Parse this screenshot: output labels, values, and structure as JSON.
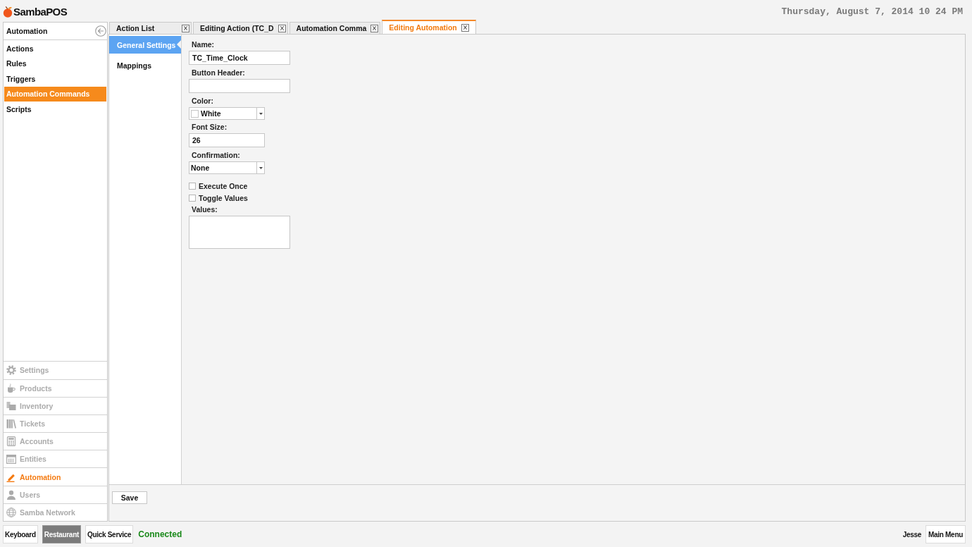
{
  "header": {
    "logo": "SambaPOS",
    "datetime": "Thursday, August 7, 2014 10 24 PM"
  },
  "sidebar": {
    "title": "Automation",
    "items": [
      {
        "label": "Actions",
        "selected": false
      },
      {
        "label": "Rules",
        "selected": false
      },
      {
        "label": "Triggers",
        "selected": false
      },
      {
        "label": "Automation Commands",
        "selected": true
      },
      {
        "label": "Scripts",
        "selected": false
      }
    ],
    "modules": [
      {
        "label": "Settings",
        "selected": false
      },
      {
        "label": "Products",
        "selected": false
      },
      {
        "label": "Inventory",
        "selected": false
      },
      {
        "label": "Tickets",
        "selected": false
      },
      {
        "label": "Accounts",
        "selected": false
      },
      {
        "label": "Entities",
        "selected": false
      },
      {
        "label": "Automation",
        "selected": true
      },
      {
        "label": "Users",
        "selected": false
      },
      {
        "label": "Samba Network",
        "selected": false
      }
    ]
  },
  "tabs": [
    {
      "label": "Action List",
      "selected": false
    },
    {
      "label": "Editing Action (TC_D",
      "selected": false
    },
    {
      "label": "Automation Comma",
      "selected": false
    },
    {
      "label": "Editing Automation",
      "selected": true
    }
  ],
  "editor": {
    "sections": [
      {
        "label": "General Settings",
        "selected": true
      },
      {
        "label": "Mappings",
        "selected": false
      }
    ],
    "fields": [
      {
        "kind": "text",
        "label": "Name:",
        "value": "TC_Time_Clock"
      },
      {
        "kind": "text",
        "label": "Button Header:"
      },
      {
        "kind": "dropdown",
        "label": "Color:",
        "value": "White",
        "color": "#ffffff"
      },
      {
        "kind": "number",
        "label": "Font Size:",
        "value": "26"
      },
      {
        "kind": "dropdown",
        "label": "Confirmation:",
        "value": "None"
      },
      {
        "kind": "checkbox",
        "label": "Execute Once",
        "checked": false
      },
      {
        "kind": "checkbox",
        "label": "Toggle Values",
        "checked": false
      },
      {
        "kind": "textarea",
        "label": "Values:"
      }
    ],
    "save_button": "Save"
  },
  "status_bar": {
    "departments": [
      {
        "label": "Keyboard",
        "selected": false
      },
      {
        "label": "Restaurant",
        "selected": true
      },
      {
        "label": "Quick Service",
        "selected": false
      }
    ],
    "connection": "Connected",
    "user": "Jesse",
    "main_menu": "Main Menu"
  }
}
